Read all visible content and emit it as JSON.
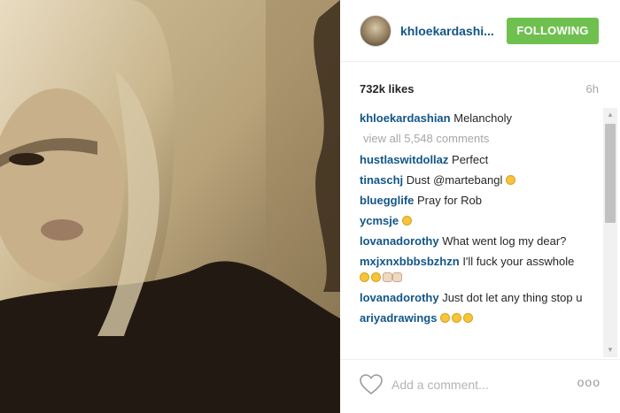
{
  "post": {
    "username": "khloekardashi...",
    "follow_label": "FOLLOWING",
    "likes": "732k likes",
    "time": "6h"
  },
  "caption": {
    "user": "khloekardashian",
    "text": "Melancholy"
  },
  "view_all": "view all 5,548 comments",
  "comments": [
    {
      "user": "hustlaswitdollaz",
      "text": "Perfect"
    },
    {
      "user": "tinaschj",
      "text": "Dust @martebangl"
    },
    {
      "user": "bluegglife",
      "text": "Pray for Rob"
    },
    {
      "user": "ycmsje",
      "text": ""
    },
    {
      "user": "lovanadorothy",
      "text": "What went log my dear?"
    },
    {
      "user": "mxjxnxbbbsbzhzn",
      "text": "I'll fuck your asswhole"
    },
    {
      "user": "lovanadorothy",
      "text": "Just dot let any thing stop u"
    },
    {
      "user": "ariyadrawings",
      "text": ""
    }
  ],
  "footer": {
    "placeholder": "Add a comment...",
    "more": "ooo"
  },
  "colors": {
    "follow_green": "#70c050",
    "link_blue": "#125688",
    "muted_gray": "#a5a7aa"
  },
  "icons": [
    "heart-icon",
    "more-options-icon",
    "scroll-up-arrow-icon",
    "scroll-down-arrow-icon"
  ]
}
